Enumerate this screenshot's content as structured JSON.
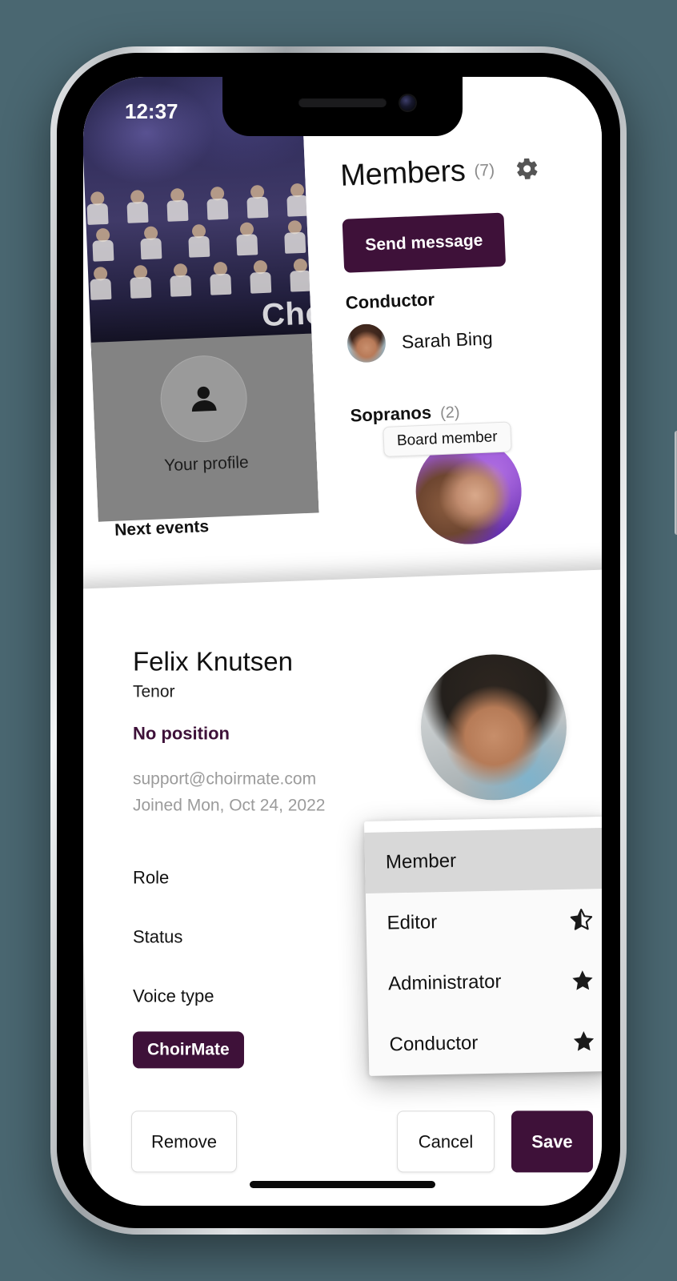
{
  "status_bar": {
    "time": "12:37"
  },
  "background_app": {
    "left_pane": {
      "photo_title": "Cho",
      "profile_label": "Your profile",
      "profile_icon": "person-icon",
      "next_events_label": "Next events"
    },
    "members_pane": {
      "title": "Members",
      "count": "(7)",
      "settings_icon": "gear-icon",
      "send_message_label": "Send message",
      "sections": [
        {
          "heading": "Conductor",
          "count": "",
          "members": [
            {
              "name": "Sarah Bing"
            }
          ]
        },
        {
          "heading": "Sopranos",
          "count": "(2)",
          "members": [
            {
              "name": "",
              "badge": "Board member"
            }
          ]
        }
      ]
    }
  },
  "detail_card": {
    "name": "Felix Knutsen",
    "voice_type": "Tenor",
    "position": "No position",
    "email": "support@choirmate.com",
    "joined": "Joined Mon, Oct 24, 2022",
    "fields": [
      {
        "label": "Role"
      },
      {
        "label": "Status"
      },
      {
        "label": "Voice type"
      }
    ],
    "app_badge": "ChoirMate",
    "buttons": {
      "remove": "Remove",
      "cancel": "Cancel",
      "save": "Save"
    }
  },
  "role_dropdown": {
    "options": [
      {
        "label": "Member",
        "selected": true,
        "star": "none"
      },
      {
        "label": "Editor",
        "selected": false,
        "star": "half"
      },
      {
        "label": "Administrator",
        "selected": false,
        "star": "full"
      },
      {
        "label": "Conductor",
        "selected": false,
        "star": "full"
      }
    ]
  },
  "colors": {
    "brand_purple": "#3e1139",
    "page_background": "#4a6771",
    "muted_text": "#9b9b9b",
    "selected_row": "#d8d8d8"
  }
}
